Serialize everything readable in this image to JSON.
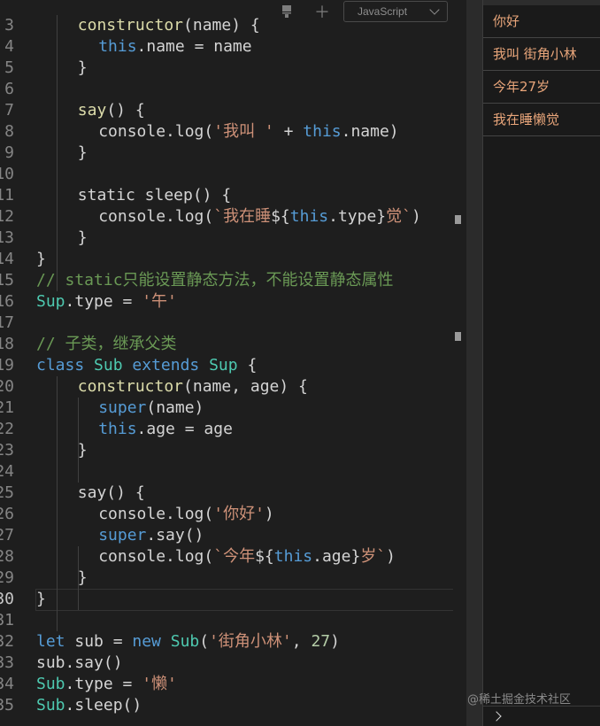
{
  "toolbar": {
    "icons": [
      "format-icon",
      "add-icon"
    ],
    "language": "JavaScript"
  },
  "code_lines": [
    {
      "n": "3",
      "indent": 2,
      "tokens": [
        [
          "fn",
          "constructor"
        ],
        [
          "plain",
          "(name) {"
        ]
      ]
    },
    {
      "n": "4",
      "indent": 3,
      "tokens": [
        [
          "kw",
          "this"
        ],
        [
          "plain",
          ".name = name"
        ]
      ]
    },
    {
      "n": "5",
      "indent": 2,
      "tokens": [
        [
          "plain",
          "}"
        ]
      ]
    },
    {
      "n": "6",
      "indent": 0,
      "tokens": []
    },
    {
      "n": "7",
      "indent": 2,
      "tokens": [
        [
          "fn",
          "say"
        ],
        [
          "plain",
          "() {"
        ]
      ]
    },
    {
      "n": "8",
      "indent": 3,
      "tokens": [
        [
          "plain",
          "console.log("
        ],
        [
          "str",
          "'我叫 '"
        ],
        [
          "plain",
          " + "
        ],
        [
          "kw",
          "this"
        ],
        [
          "plain",
          ".name)"
        ]
      ]
    },
    {
      "n": "9",
      "indent": 2,
      "tokens": [
        [
          "plain",
          "}"
        ]
      ]
    },
    {
      "n": "10",
      "indent": 0,
      "tokens": []
    },
    {
      "n": "11",
      "indent": 2,
      "tokens": [
        [
          "plain",
          "static sleep() {"
        ]
      ]
    },
    {
      "n": "12",
      "indent": 3,
      "tokens": [
        [
          "plain",
          "console.log("
        ],
        [
          "str",
          "`我在睡"
        ],
        [
          "plain",
          "${"
        ],
        [
          "kw",
          "this"
        ],
        [
          "plain",
          ".type}"
        ],
        [
          "str",
          "觉`"
        ],
        [
          "plain",
          ")"
        ]
      ]
    },
    {
      "n": "13",
      "indent": 2,
      "tokens": [
        [
          "plain",
          "}"
        ]
      ]
    },
    {
      "n": "14",
      "indent": 0,
      "tokens": [
        [
          "plain",
          "}"
        ]
      ]
    },
    {
      "n": "15",
      "indent": 0,
      "tokens": [
        [
          "cm",
          "// static只能设置静态方法，不能设置静态属性"
        ]
      ]
    },
    {
      "n": "16",
      "indent": 0,
      "tokens": [
        [
          "cls",
          "Sup"
        ],
        [
          "plain",
          ".type = "
        ],
        [
          "str",
          "'午'"
        ]
      ]
    },
    {
      "n": "17",
      "indent": 0,
      "tokens": []
    },
    {
      "n": "18",
      "indent": 0,
      "tokens": [
        [
          "cm",
          "// 子类，继承父类"
        ]
      ]
    },
    {
      "n": "19",
      "indent": 0,
      "tokens": [
        [
          "kw",
          "class "
        ],
        [
          "cls",
          "Sub "
        ],
        [
          "kw",
          "extends "
        ],
        [
          "cls",
          "Sup "
        ],
        [
          "plain",
          "{"
        ]
      ]
    },
    {
      "n": "20",
      "indent": 2,
      "tokens": [
        [
          "fn",
          "constructor"
        ],
        [
          "plain",
          "(name, age) {"
        ]
      ]
    },
    {
      "n": "21",
      "indent": 3,
      "tokens": [
        [
          "kw",
          "super"
        ],
        [
          "plain",
          "(name)"
        ]
      ]
    },
    {
      "n": "22",
      "indent": 3,
      "tokens": [
        [
          "kw",
          "this"
        ],
        [
          "plain",
          ".age = age"
        ]
      ]
    },
    {
      "n": "23",
      "indent": 2,
      "tokens": [
        [
          "plain",
          "}"
        ]
      ]
    },
    {
      "n": "24",
      "indent": 0,
      "tokens": []
    },
    {
      "n": "25",
      "indent": 2,
      "tokens": [
        [
          "plain",
          "say() {"
        ]
      ]
    },
    {
      "n": "26",
      "indent": 3,
      "tokens": [
        [
          "plain",
          "console.log("
        ],
        [
          "str",
          "'你好'"
        ],
        [
          "plain",
          ")"
        ]
      ]
    },
    {
      "n": "27",
      "indent": 3,
      "tokens": [
        [
          "kw",
          "super"
        ],
        [
          "plain",
          ".say()"
        ]
      ]
    },
    {
      "n": "28",
      "indent": 3,
      "tokens": [
        [
          "plain",
          "console.log("
        ],
        [
          "str",
          "`今年"
        ],
        [
          "plain",
          "${"
        ],
        [
          "kw",
          "this"
        ],
        [
          "plain",
          ".age}"
        ],
        [
          "str",
          "岁`"
        ],
        [
          "plain",
          ")"
        ]
      ]
    },
    {
      "n": "29",
      "indent": 2,
      "tokens": [
        [
          "plain",
          "}"
        ]
      ]
    },
    {
      "n": "30",
      "indent": 0,
      "tokens": [
        [
          "plain",
          "}"
        ]
      ],
      "current": true
    },
    {
      "n": "31",
      "indent": 0,
      "tokens": []
    },
    {
      "n": "32",
      "indent": 0,
      "tokens": [
        [
          "kw",
          "let"
        ],
        [
          "plain",
          " sub = "
        ],
        [
          "kw",
          "new "
        ],
        [
          "cls",
          "Sub"
        ],
        [
          "plain",
          "("
        ],
        [
          "str",
          "'街角小林'"
        ],
        [
          "plain",
          ", "
        ],
        [
          "num",
          "27"
        ],
        [
          "plain",
          ")"
        ]
      ]
    },
    {
      "n": "33",
      "indent": 0,
      "tokens": [
        [
          "plain",
          "sub.say()"
        ]
      ]
    },
    {
      "n": "34",
      "indent": 0,
      "tokens": [
        [
          "cls",
          "Sub"
        ],
        [
          "plain",
          ".type = "
        ],
        [
          "str",
          "'懒'"
        ]
      ]
    },
    {
      "n": "35",
      "indent": 0,
      "tokens": [
        [
          "cls",
          "Sub"
        ],
        [
          "plain",
          ".sleep()"
        ]
      ]
    }
  ],
  "console": {
    "lines": [
      "你好",
      "我叫 街角小林",
      "今年27岁",
      "我在睡懒觉"
    ]
  },
  "watermark": "@稀土掘金技术社区",
  "colors": {
    "keyword": "#569cd6",
    "class": "#4ec9b0",
    "function": "#dcdcaa",
    "string": "#ce9178",
    "number": "#b5cea8",
    "comment": "#6a9955",
    "console_text": "#e8a57a"
  }
}
